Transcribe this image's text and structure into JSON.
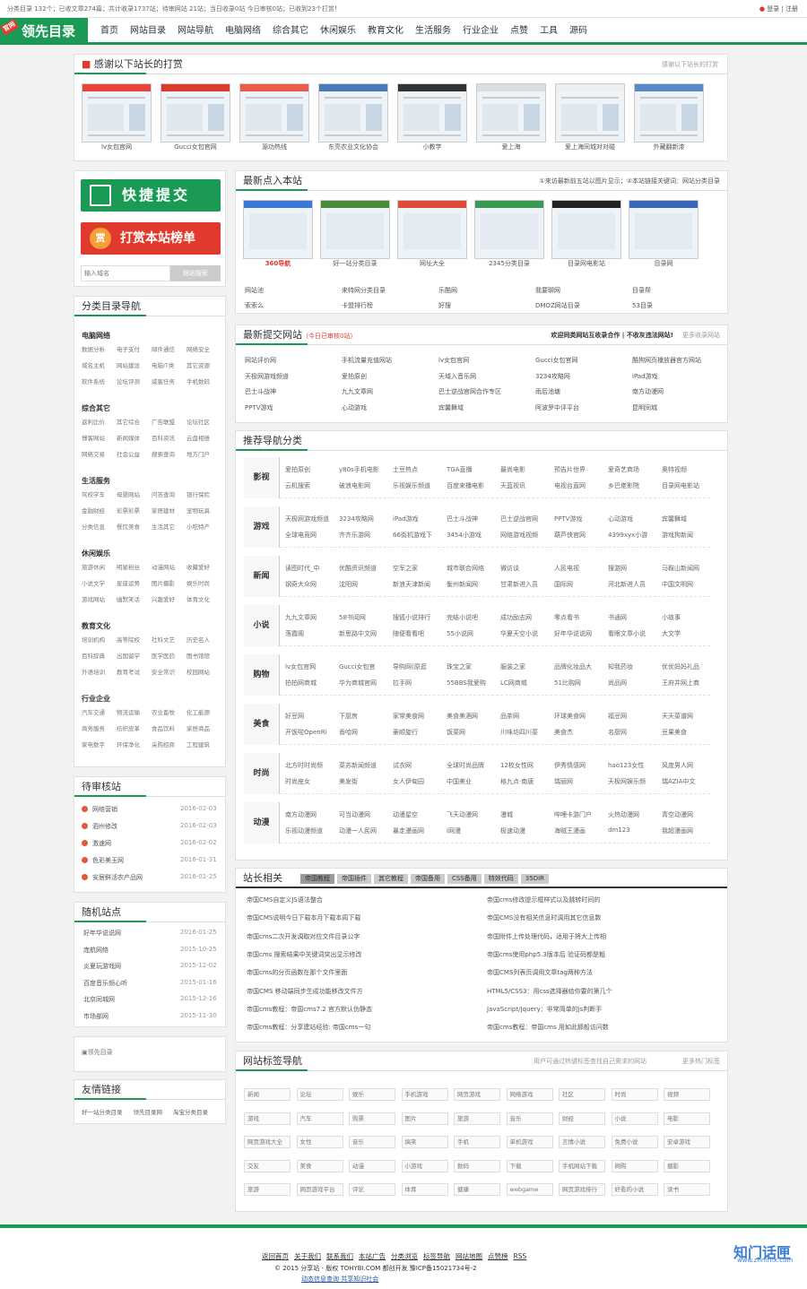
{
  "topbar": {
    "text": "分类目录 132个；已收文章274篇；共计收录1737站；待审网站 21站；当日收录0站 今日审核0站；已收到23个打赏！",
    "right": [
      "登录",
      "注册"
    ]
  },
  "logo": {
    "text": "领先目录",
    "badge": "官网"
  },
  "nav": [
    "首页",
    "网站目录",
    "网站导航",
    "电脑网络",
    "综合其它",
    "休闲娱乐",
    "教育文化",
    "生活服务",
    "行业企业",
    "点赞",
    "工具",
    "源码"
  ],
  "thanks": {
    "title": "感谢以下站长的打赏",
    "right": "感谢以下站长的打赏",
    "items": [
      "lv女包官网",
      "Gucci女包官网",
      "源功热线",
      "东亮农业文化协会",
      "小教学",
      "爱上海",
      "爱上海同城对对碰",
      "外藏翻新漆"
    ]
  },
  "side": {
    "btn_submit": "快捷提交",
    "btn_reward": "打赏本站榜单",
    "reward_icon": "赏",
    "search_placeholder": "输入域名",
    "search_btn": "网站搜索"
  },
  "latest": {
    "title": "最新点入本站",
    "right": "①来访最新前五站以图片显示；②本站链接关键词：网站分类目录",
    "thumbs": [
      "360导航",
      "好一站分类目录",
      "网址大全",
      "2345分类目录",
      "目录网电影站",
      "目录网"
    ],
    "links": [
      "网站池",
      "来特网分类目录",
      "乐酷网",
      "我要聊网",
      "目录帮",
      "索索么",
      "卡盟排行榜",
      "好搜",
      "DMOZ网站目录",
      "53目录"
    ]
  },
  "newsubmit": {
    "title": "最新提交网站",
    "today": "（今日已审核0站）",
    "right": "欢迎同类网站互收录合作 | 不收灰违法网站!",
    "more": "更多收录网站",
    "items": [
      "网站评价网",
      "手机流量充值网站",
      "lv女包官网",
      "Gucci女包官网",
      "酷狗网页播放器官方网站",
      "天极网游戏频道",
      "爱拍原创",
      "天域入音乐网",
      "3234攻略网",
      "iPad游戏",
      "巴士斗战神",
      "九九文章网",
      "巴士逆战官网合作专区",
      "雨后池塘",
      "南方动漫网",
      "PPTV游戏",
      "心动游戏",
      "宾馨舞域",
      "阿波罗中评平台",
      "昆明同城"
    ]
  },
  "catnav": {
    "title": "推荐导航分类",
    "rows": [
      {
        "name": "影视",
        "links": [
          "爱拍原创",
          "y80s手机电影",
          "土豆热点",
          "TGA直播",
          "最尚电影",
          "预告片世界",
          "爱奇艺商场",
          "奥特视频",
          "云机搜索",
          "破浪电影网",
          "乐视娱乐频道",
          "百度来播电影",
          "天蓝视讯",
          "电视台直网",
          "乡巴佬影院",
          "目录网电影站"
        ]
      },
      {
        "name": "游戏",
        "links": [
          "天极网游戏频道",
          "3234攻略网",
          "iPad游戏",
          "巴士斗战神",
          "巴士逆战官网",
          "PPTV游戏",
          "心动游戏",
          "宾馨舞域",
          "全球电竞网",
          "齐齐乐游网",
          "66街机游戏下",
          "3454小游戏",
          "网络游戏视频",
          "葫芦侠官网",
          "4399xyx小游",
          "游戏狗新闻"
        ]
      },
      {
        "name": "新闻",
        "links": [
          "读图时代_中",
          "优酷资讯频道",
          "空军之家",
          "城市联合网络",
          "微访谈",
          "人民电视",
          "搜游网",
          "马鞍山新闻网",
          "钢奇大众网",
          "沈阳网",
          "新浪天津新闻",
          "衡州新闻网",
          "甘肃新进入员",
          "国际网",
          "河北新进人员",
          "中国文明网"
        ]
      },
      {
        "name": "小说",
        "links": [
          "九九文章网",
          "58书阅网",
          "搜狐小说排行",
          "完结小说吧",
          "成功励志网",
          "零点看书",
          "书通网",
          "小故事",
          "落霞阁",
          "新思路中文网",
          "随便看看吧",
          "55小说网",
          "华夏天空小说",
          "好年华说说网",
          "看眼文章小说",
          "大文学"
        ]
      },
      {
        "name": "购物",
        "links": [
          "lv女包官网",
          "Gucci女包官",
          "导购网(原逛",
          "珠宝之家",
          "服装之家",
          "品牌化妆品大",
          "知我药妆",
          "优优妈妈礼品",
          "拍拍网商城",
          "华为商城官网",
          "拉手网",
          "55BBS我爱购",
          "LC网商城",
          "51比购网",
          "尚品网",
          "王府井网上商"
        ]
      },
      {
        "name": "美食",
        "links": [
          "好豆网",
          "下厨房",
          "家常美食网",
          "美食美酒网",
          "品茶网",
          "环球美食网",
          "福豆网",
          "天天菜谱网",
          "开饭啦OpenRi",
          "香哈网",
          "豪顺旋行",
          "饭菜网",
          "川味坊四川菜",
          "美食杰",
          "名厨网",
          "豆果美食"
        ]
      },
      {
        "name": "时尚",
        "links": [
          "北方时时尚频",
          "菜苏新闻频道",
          "试衣网",
          "全球时尚品牌",
          "12枚女性网",
          "伊秀情感网",
          "hao123女性",
          "风度男人网",
          "时尚座女",
          "美发街",
          "女人伊甸园",
          "中国美业",
          "格九点·南唐",
          "瑞丽网",
          "天极网娱乐频",
          "瑞AZIA中文"
        ]
      },
      {
        "name": "动漫",
        "links": [
          "南方动漫网",
          "可当动漫网",
          "动漫星空",
          "飞天动漫网",
          "漫城",
          "哔哩卡游门户",
          "火热动漫网",
          "青空动漫网",
          "乐视动漫频道",
          "动漫一人民网",
          "暴走漫画网",
          "i网漫",
          "极速动漫",
          "海贼王漫画",
          "dm123",
          "我超漫画网"
        ]
      }
    ]
  },
  "stationmaster": {
    "title": "站长相关",
    "tabs": [
      "帝国教程",
      "帝国插件",
      "其它教程",
      "帝国备用",
      "CSS备用",
      "特效代码",
      "35DIR"
    ],
    "left": [
      "帝国CMS自定义JS语法整合",
      "帝国CMS说明今日下载本月下载本周下载",
      "帝国cms二次开发调取对应文件目录公字",
      "帝国cms 搜索结果中关键词突出显示修改",
      "帝国cms的分页函数在那个文件里面",
      "帝国CMS 移动端同步生成功能移改文件方",
      "帝国cms教程：帝国cms7.2 官方默认伪静态",
      "帝国cms教程：分享建站经验: 帝国cms一句"
    ],
    "right": [
      "帝国cms修改提示框样式以及跳转时间的",
      "帝国CMS没有相关信息时调用其它信息数",
      "帝国附件上传处理代码，适用于将大上传相",
      "帝国cms使用php5.3版本后 验证码都是粗",
      "帝国CMS列表页调用文章tag两种方法",
      "HTML5/CSS3：用css选择器给你要的第几个",
      "JavaScript/Jquery：非常简单的js判断手",
      "帝国cms教程：帝国cms 用如此那般访问数"
    ]
  },
  "tags": {
    "title": "网站标签导航",
    "right": "用户可通过热键标签查找自己需求的网站",
    "more": "更多热门标签",
    "items": [
      "新闻",
      "论坛",
      "娱乐",
      "手机游戏",
      "网页游戏",
      "网络游戏",
      "社区",
      "时尚",
      "视频",
      "游戏",
      "汽车",
      "购票",
      "图片",
      "旅游",
      "音乐",
      "财经",
      "小说",
      "电影",
      "网页游戏大全",
      "女性",
      "音乐",
      "搞笑",
      "手机",
      "单机游戏",
      "言情小说",
      "免费小说",
      "安卓游戏",
      "交友",
      "美食",
      "动漫",
      "小游戏",
      "数码",
      "下载",
      "手机网站下载",
      "网购",
      "摄影",
      "旅游",
      "网页游戏平台",
      "评论",
      "体育",
      "健康",
      "webgame",
      "网页游戏排行",
      "好看的小说",
      "读书"
    ]
  },
  "pending": {
    "title": "待审核站",
    "items": [
      [
        "网络营销",
        "2016-02-03"
      ],
      [
        "泗州修改",
        "2016-02-03"
      ],
      [
        "激速网",
        "2016-02-02"
      ],
      [
        "色彩美玉网",
        "2016-01-31"
      ],
      [
        "安居鲜活农产品网",
        "2016-01-25"
      ]
    ]
  },
  "random": {
    "title": "随机站点",
    "items": [
      [
        "好年华说说网",
        "2016-01-25"
      ],
      [
        "庞航网络",
        "2015-10-25"
      ],
      [
        "炎夏玩游戏网",
        "2015-12-02"
      ],
      [
        "百度音乐频心听",
        "2015-01-16"
      ],
      [
        "北京同城网",
        "2015-12-16"
      ],
      [
        "市场部网",
        "2015-11-30"
      ]
    ]
  },
  "partner": {
    "logo_alt": "领先目录"
  },
  "friends": {
    "title": "友情链接",
    "items": [
      "好一站分类目录",
      "领先目录网",
      "淘宝分类目录"
    ]
  },
  "sidecats": [
    {
      "name": "电脑网络",
      "links": [
        "数据分析",
        "电子支付",
        "邮件通信",
        "网络安全",
        "域名主机",
        "网站建设",
        "电脑IT类",
        "其它资源",
        "软件系统",
        "论坛评测",
        "威客任务",
        "手机数码"
      ]
    },
    {
      "name": "综合其它",
      "links": [
        "返利比价",
        "其它综合",
        "广告联盟",
        "论坛社区",
        "博客网站",
        "新闻媒体",
        "百科资讯",
        "云盘相册",
        "网络交易",
        "社会公益",
        "搜索查询",
        "地方门户"
      ]
    },
    {
      "name": "生活服务",
      "links": [
        "驾校学车",
        "母婴网站",
        "问答查询",
        "银行保险",
        "金融财经",
        "彩票彩票",
        "家居建材",
        "宠物玩具",
        "分类信息",
        "餐饮美食",
        "生活其它",
        "小吃特产"
      ]
    },
    {
      "name": "休闲娱乐",
      "links": [
        "旅游休闲",
        "明星粉丝",
        "动漫网站",
        "收藏爱好",
        "小说文学",
        "星座运势",
        "图片摄影",
        "娱乐时尚",
        "游戏网站",
        "幽默笑话",
        "兴趣爱好",
        "体育文化"
      ]
    },
    {
      "name": "教育文化",
      "links": [
        "培训机构",
        "高等院校",
        "社科文艺",
        "历史名人",
        "百科辞典",
        "出国留学",
        "医学医药",
        "图书馆馆",
        "外语培训",
        "教育考试",
        "安全常识",
        "校园网站"
      ]
    },
    {
      "name": "行业企业",
      "links": [
        "汽车交通",
        "物流运输",
        "农业畜牧",
        "化工能源",
        "商务服务",
        "纺织皮革",
        "食品饮料",
        "家居商品",
        "家电数字",
        "环保净化",
        "采购招商",
        "工程建筑"
      ]
    }
  ],
  "footer": {
    "links": [
      "返回首页",
      "关于我们",
      "联系我们",
      "本站广告",
      "分类浏览",
      "标签导航",
      "网站地图",
      "点赞榜",
      "RSS"
    ],
    "copy": "© 2015 分享站 - 版权 TOHYBI.COM 都创开发 豫ICP备15021734号-2",
    "line2": "动态信息查询 共享知识社会",
    "watermark": "知门话匣",
    "watermark_sub": "www.zhmrhx.com"
  },
  "colors": {
    "brand": "#1a9a54",
    "accent": "#e03a2e"
  }
}
